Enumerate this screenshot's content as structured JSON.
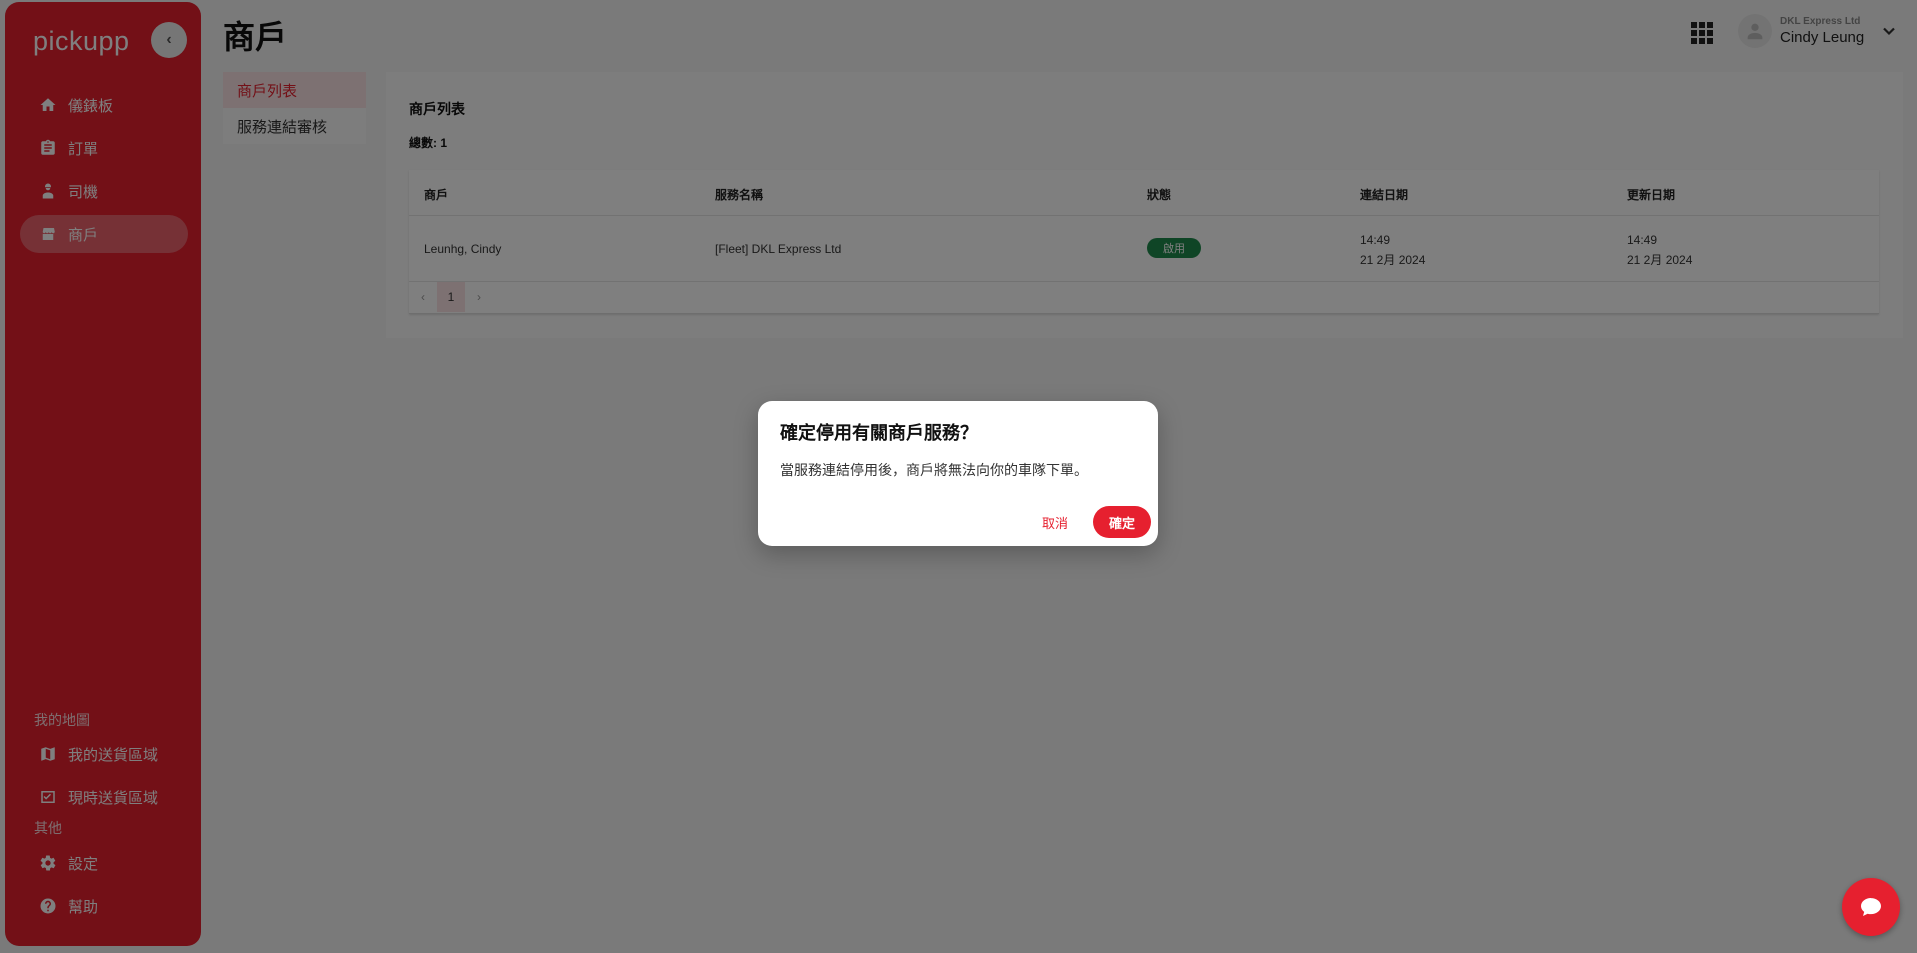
{
  "sidebar": {
    "logo": "pickupp",
    "collapse_icon": "chevron-left-icon",
    "items": [
      {
        "label": "儀錶板",
        "icon": "home-icon"
      },
      {
        "label": "訂單",
        "icon": "clipboard-icon"
      },
      {
        "label": "司機",
        "icon": "driver-icon"
      },
      {
        "label": "商戶",
        "icon": "store-icon",
        "active": true
      }
    ],
    "map_section_label": "我的地圖",
    "map_items": [
      {
        "label": "我的送貨區域",
        "icon": "map-icon"
      },
      {
        "label": "現時送貨區域",
        "icon": "checkbox-icon"
      }
    ],
    "other_section_label": "其他",
    "other_items": [
      {
        "label": "設定",
        "icon": "gear-icon"
      },
      {
        "label": "幫助",
        "icon": "help-icon"
      }
    ]
  },
  "header": {
    "title": "商戶",
    "apps_icon": "apps-grid-icon",
    "company": "DKL Express Ltd",
    "username": "Cindy Leung"
  },
  "subnav": {
    "items": [
      {
        "label": "商戶列表",
        "active": true
      },
      {
        "label": "服務連結審核"
      }
    ]
  },
  "main": {
    "title": "商戶列表",
    "total": "總數: 1",
    "columns": [
      "商戶",
      "服務名稱",
      "狀態",
      "連結日期",
      "更新日期"
    ],
    "rows": [
      {
        "merchant": "Leunhg, Cindy",
        "service": "[Fleet] DKL Express Ltd",
        "status": "啟用",
        "linked_time": "14:49",
        "linked_date": "21 2月 2024",
        "updated_time": "14:49",
        "updated_date": "21 2月 2024"
      }
    ],
    "pagination": {
      "prev": "‹",
      "current": "1",
      "next": "›"
    }
  },
  "dialog": {
    "title": "確定停用有關商戶服務？",
    "message": "當服務連結停用後，商戶將無法向你的車隊下單。",
    "cancel_label": "取消",
    "confirm_label": "確定"
  },
  "colors": {
    "brand": "#e6202f",
    "status_active": "#1f8a4c"
  },
  "chat_icon": "chat-bubble-icon"
}
